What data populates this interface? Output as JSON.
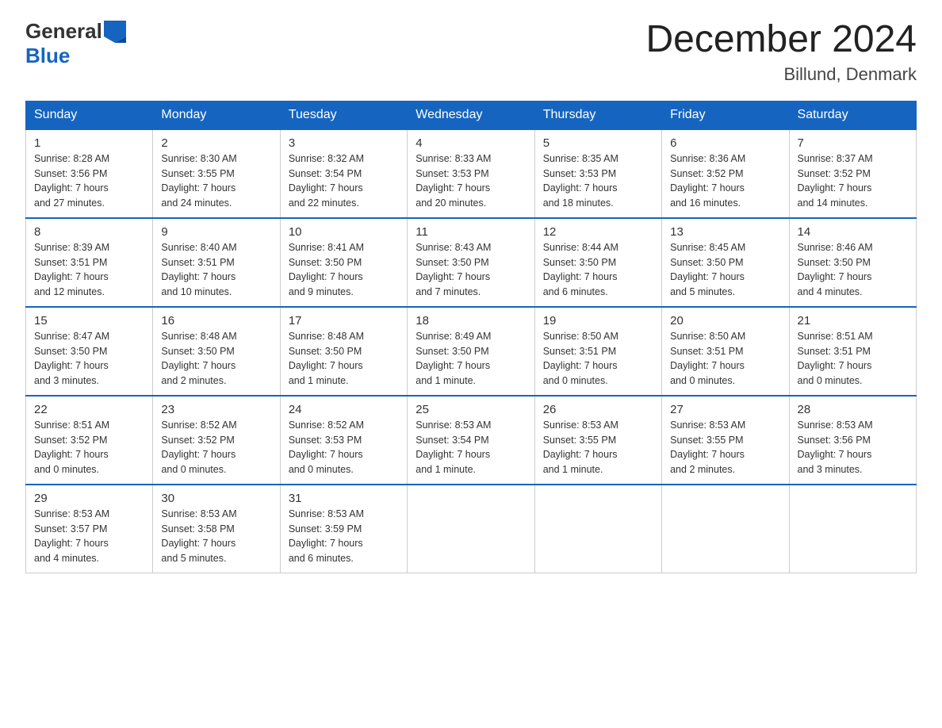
{
  "header": {
    "logo_general": "General",
    "logo_blue": "Blue",
    "title": "December 2024",
    "subtitle": "Billund, Denmark"
  },
  "days_of_week": [
    "Sunday",
    "Monday",
    "Tuesday",
    "Wednesday",
    "Thursday",
    "Friday",
    "Saturday"
  ],
  "weeks": [
    [
      {
        "day": "1",
        "sunrise": "8:28 AM",
        "sunset": "3:56 PM",
        "daylight": "7 hours and 27 minutes."
      },
      {
        "day": "2",
        "sunrise": "8:30 AM",
        "sunset": "3:55 PM",
        "daylight": "7 hours and 24 minutes."
      },
      {
        "day": "3",
        "sunrise": "8:32 AM",
        "sunset": "3:54 PM",
        "daylight": "7 hours and 22 minutes."
      },
      {
        "day": "4",
        "sunrise": "8:33 AM",
        "sunset": "3:53 PM",
        "daylight": "7 hours and 20 minutes."
      },
      {
        "day": "5",
        "sunrise": "8:35 AM",
        "sunset": "3:53 PM",
        "daylight": "7 hours and 18 minutes."
      },
      {
        "day": "6",
        "sunrise": "8:36 AM",
        "sunset": "3:52 PM",
        "daylight": "7 hours and 16 minutes."
      },
      {
        "day": "7",
        "sunrise": "8:37 AM",
        "sunset": "3:52 PM",
        "daylight": "7 hours and 14 minutes."
      }
    ],
    [
      {
        "day": "8",
        "sunrise": "8:39 AM",
        "sunset": "3:51 PM",
        "daylight": "7 hours and 12 minutes."
      },
      {
        "day": "9",
        "sunrise": "8:40 AM",
        "sunset": "3:51 PM",
        "daylight": "7 hours and 10 minutes."
      },
      {
        "day": "10",
        "sunrise": "8:41 AM",
        "sunset": "3:50 PM",
        "daylight": "7 hours and 9 minutes."
      },
      {
        "day": "11",
        "sunrise": "8:43 AM",
        "sunset": "3:50 PM",
        "daylight": "7 hours and 7 minutes."
      },
      {
        "day": "12",
        "sunrise": "8:44 AM",
        "sunset": "3:50 PM",
        "daylight": "7 hours and 6 minutes."
      },
      {
        "day": "13",
        "sunrise": "8:45 AM",
        "sunset": "3:50 PM",
        "daylight": "7 hours and 5 minutes."
      },
      {
        "day": "14",
        "sunrise": "8:46 AM",
        "sunset": "3:50 PM",
        "daylight": "7 hours and 4 minutes."
      }
    ],
    [
      {
        "day": "15",
        "sunrise": "8:47 AM",
        "sunset": "3:50 PM",
        "daylight": "7 hours and 3 minutes."
      },
      {
        "day": "16",
        "sunrise": "8:48 AM",
        "sunset": "3:50 PM",
        "daylight": "7 hours and 2 minutes."
      },
      {
        "day": "17",
        "sunrise": "8:48 AM",
        "sunset": "3:50 PM",
        "daylight": "7 hours and 1 minute."
      },
      {
        "day": "18",
        "sunrise": "8:49 AM",
        "sunset": "3:50 PM",
        "daylight": "7 hours and 1 minute."
      },
      {
        "day": "19",
        "sunrise": "8:50 AM",
        "sunset": "3:51 PM",
        "daylight": "7 hours and 0 minutes."
      },
      {
        "day": "20",
        "sunrise": "8:50 AM",
        "sunset": "3:51 PM",
        "daylight": "7 hours and 0 minutes."
      },
      {
        "day": "21",
        "sunrise": "8:51 AM",
        "sunset": "3:51 PM",
        "daylight": "7 hours and 0 minutes."
      }
    ],
    [
      {
        "day": "22",
        "sunrise": "8:51 AM",
        "sunset": "3:52 PM",
        "daylight": "7 hours and 0 minutes."
      },
      {
        "day": "23",
        "sunrise": "8:52 AM",
        "sunset": "3:52 PM",
        "daylight": "7 hours and 0 minutes."
      },
      {
        "day": "24",
        "sunrise": "8:52 AM",
        "sunset": "3:53 PM",
        "daylight": "7 hours and 0 minutes."
      },
      {
        "day": "25",
        "sunrise": "8:53 AM",
        "sunset": "3:54 PM",
        "daylight": "7 hours and 1 minute."
      },
      {
        "day": "26",
        "sunrise": "8:53 AM",
        "sunset": "3:55 PM",
        "daylight": "7 hours and 1 minute."
      },
      {
        "day": "27",
        "sunrise": "8:53 AM",
        "sunset": "3:55 PM",
        "daylight": "7 hours and 2 minutes."
      },
      {
        "day": "28",
        "sunrise": "8:53 AM",
        "sunset": "3:56 PM",
        "daylight": "7 hours and 3 minutes."
      }
    ],
    [
      {
        "day": "29",
        "sunrise": "8:53 AM",
        "sunset": "3:57 PM",
        "daylight": "7 hours and 4 minutes."
      },
      {
        "day": "30",
        "sunrise": "8:53 AM",
        "sunset": "3:58 PM",
        "daylight": "7 hours and 5 minutes."
      },
      {
        "day": "31",
        "sunrise": "8:53 AM",
        "sunset": "3:59 PM",
        "daylight": "7 hours and 6 minutes."
      },
      null,
      null,
      null,
      null
    ]
  ],
  "labels": {
    "sunrise": "Sunrise:",
    "sunset": "Sunset:",
    "daylight": "Daylight:"
  }
}
